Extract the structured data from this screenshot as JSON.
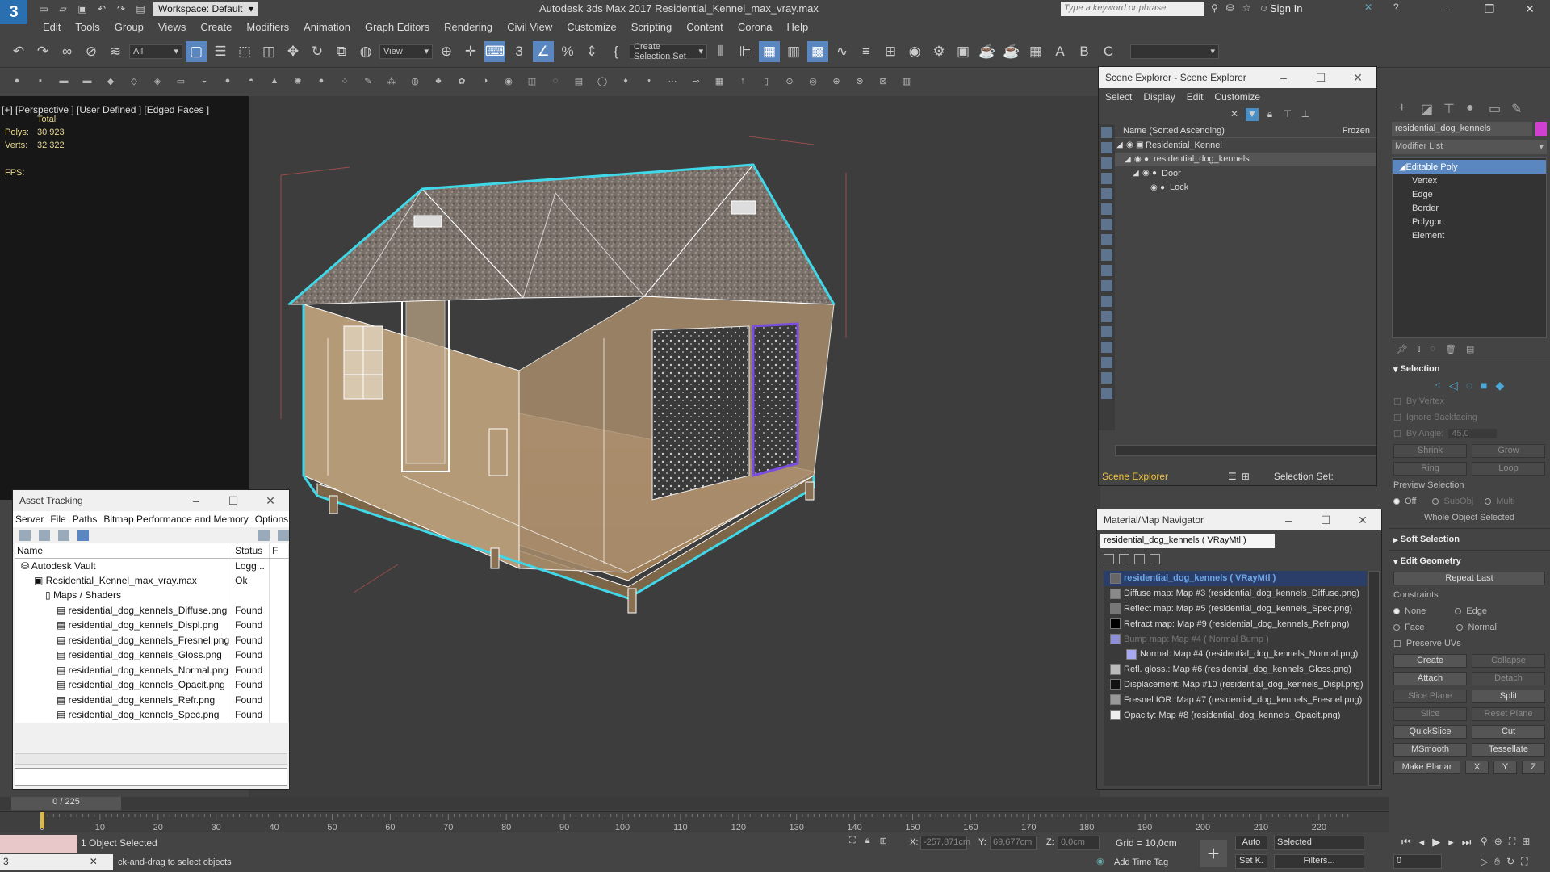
{
  "app": {
    "title": "Autodesk 3ds Max 2017    Residential_Kennel_max_vray.max",
    "workspace": "Workspace: Default",
    "search_placeholder": "Type a keyword or phrase",
    "sign_in": "Sign In"
  },
  "menu": [
    "Edit",
    "Tools",
    "Group",
    "Views",
    "Create",
    "Modifiers",
    "Animation",
    "Graph Editors",
    "Rendering",
    "Civil View",
    "Customize",
    "Scripting",
    "Content",
    "Corona",
    "Help"
  ],
  "toolbar": {
    "filter": "All",
    "view_dd": "View",
    "selection_set": "Create Selection Set"
  },
  "viewport": {
    "label": "[+] [Perspective ] [User Defined ] [Edged Faces ]",
    "total_label": "Total",
    "polys_label": "Polys:",
    "polys": "30 923",
    "verts_label": "Verts:",
    "verts": "32 322",
    "fps_label": "FPS:"
  },
  "asset_tracking": {
    "title": "Asset Tracking",
    "menu": [
      "Server",
      "File",
      "Paths",
      "Bitmap Performance and Memory",
      "Options"
    ],
    "col_name": "Name",
    "col_status": "Status",
    "col_extra": "F",
    "rows": [
      {
        "name": "Autodesk Vault",
        "status": "Logg...",
        "indent": 0
      },
      {
        "name": "Residential_Kennel_max_vray.max",
        "status": "Ok",
        "indent": 1
      },
      {
        "name": "Maps / Shaders",
        "status": "",
        "indent": 2
      },
      {
        "name": "residential_dog_kennels_Diffuse.png",
        "status": "Found",
        "indent": 3
      },
      {
        "name": "residential_dog_kennels_Displ.png",
        "status": "Found",
        "indent": 3
      },
      {
        "name": "residential_dog_kennels_Fresnel.png",
        "status": "Found",
        "indent": 3
      },
      {
        "name": "residential_dog_kennels_Gloss.png",
        "status": "Found",
        "indent": 3
      },
      {
        "name": "residential_dog_kennels_Normal.png",
        "status": "Found",
        "indent": 3
      },
      {
        "name": "residential_dog_kennels_Opacit.png",
        "status": "Found",
        "indent": 3
      },
      {
        "name": "residential_dog_kennels_Refr.png",
        "status": "Found",
        "indent": 3
      },
      {
        "name": "residential_dog_kennels_Spec.png",
        "status": "Found",
        "indent": 3
      }
    ]
  },
  "scene_explorer": {
    "title": "Scene Explorer - Scene Explorer",
    "menu": [
      "Select",
      "Display",
      "Edit",
      "Customize"
    ],
    "col_name": "Name (Sorted Ascending)",
    "col_frozen": "Frozen",
    "rows": [
      {
        "name": "Residential_Kennel",
        "indent": 0
      },
      {
        "name": "residential_dog_kennels",
        "indent": 1
      },
      {
        "name": "Door",
        "indent": 2
      },
      {
        "name": "Lock",
        "indent": 3
      }
    ],
    "footer_label": "Scene Explorer",
    "selection_set": "Selection Set:"
  },
  "material_navigator": {
    "title": "Material/Map Navigator",
    "path": "residential_dog_kennels  ( VRayMtl )",
    "root": "residential_dog_kennels  ( VRayMtl )",
    "items": [
      {
        "label": "Diffuse map: Map #3 (residential_dog_kennels_Diffuse.png)",
        "swatch": "#8a8a8a",
        "dim": false
      },
      {
        "label": "Reflect map: Map #5 (residential_dog_kennels_Spec.png)",
        "swatch": "#777777",
        "dim": false
      },
      {
        "label": "Refract map: Map #9 (residential_dog_kennels_Refr.png)",
        "swatch": "#000000",
        "dim": false
      },
      {
        "label": "Bump map: Map #4  ( Normal Bump )",
        "swatch": "#8f8fd8",
        "dim": true
      },
      {
        "label": "Normal: Map #4 (residential_dog_kennels_Normal.png)",
        "swatch": "#a8a8f0",
        "dim": false
      },
      {
        "label": "Refl. gloss.: Map #6 (residential_dog_kennels_Gloss.png)",
        "swatch": "#bbbbbb",
        "dim": false
      },
      {
        "label": "Displacement: Map #10 (residential_dog_kennels_Displ.png)",
        "swatch": "#111111",
        "dim": false
      },
      {
        "label": "Fresnel IOR: Map #7 (residential_dog_kennels_Fresnel.png)",
        "swatch": "#999999",
        "dim": false
      },
      {
        "label": "Opacity: Map #8 (residential_dog_kennels_Opacit.png)",
        "swatch": "#eeeeee",
        "dim": false
      }
    ]
  },
  "command_panel": {
    "object_name": "residential_dog_kennels",
    "object_color": "#d040d0",
    "modifier_list": "Modifier List",
    "stack": [
      "Editable Poly",
      "Vertex",
      "Edge",
      "Border",
      "Polygon",
      "Element"
    ],
    "selection": {
      "header": "Selection",
      "by_vertex": "By Vertex",
      "ignore_backfacing": "Ignore Backfacing",
      "by_angle": "By Angle:",
      "angle_value": "45,0",
      "shrink": "Shrink",
      "grow": "Grow",
      "ring": "Ring",
      "loop": "Loop",
      "preview_selection": "Preview Selection",
      "off": "Off",
      "subobj": "SubObj",
      "multi": "Multi",
      "status": "Whole Object Selected"
    },
    "soft_selection": "Soft Selection",
    "edit_geometry": {
      "header": "Edit Geometry",
      "repeat_last": "Repeat Last",
      "constraints": "Constraints",
      "none": "None",
      "edge": "Edge",
      "face": "Face",
      "normal": "Normal",
      "preserve_uvs": "Preserve UVs",
      "create": "Create",
      "collapse": "Collapse",
      "attach": "Attach",
      "detach": "Detach",
      "slice_plane": "Slice Plane",
      "split": "Split",
      "slice": "Slice",
      "reset_plane": "Reset Plane",
      "quickslice": "QuickSlice",
      "cut": "Cut",
      "msmooth": "MSmooth",
      "tessellate": "Tessellate",
      "make_planar": "Make Planar",
      "x": "X",
      "y": "Y",
      "z": "Z"
    }
  },
  "timeline": {
    "frame": "0 / 225",
    "ticks": [
      "0",
      "10",
      "20",
      "30",
      "40",
      "50",
      "60",
      "70",
      "80",
      "90",
      "100",
      "110",
      "120",
      "130",
      "140",
      "150",
      "160",
      "170",
      "180",
      "190",
      "200",
      "210",
      "220"
    ]
  },
  "status": {
    "objects": "1 Object Selected",
    "prompt": "ck-and-drag to select objects",
    "x_label": "X:",
    "x": "-257,871cm",
    "y_label": "Y:",
    "y": "69,677cm",
    "z_label": "Z:",
    "z": "0,0cm",
    "grid": "Grid = 10,0cm",
    "add_time_tag": "Add Time Tag",
    "auto": "Auto",
    "selected": "Selected",
    "set_key": "Set K.",
    "filters": "Filters...",
    "frame_field": "0"
  }
}
